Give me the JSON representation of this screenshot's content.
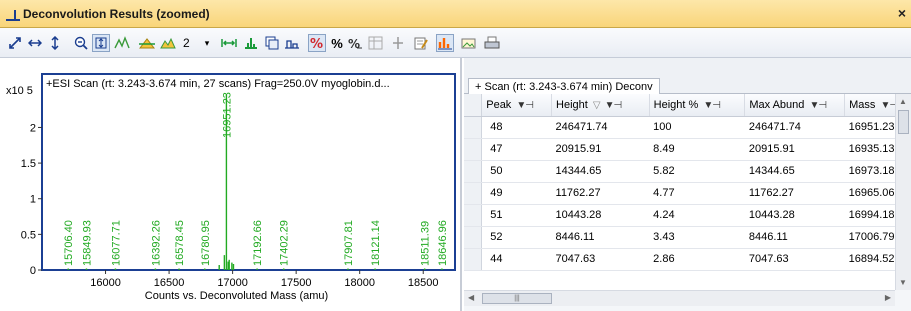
{
  "window": {
    "title": "Deconvolution Results (zoomed)",
    "close_glyph": "×",
    "title_icon": "chart-icon"
  },
  "toolbar": {
    "items": [
      "expand-arrows-icon",
      "horizontal-arrows-icon",
      "vertical-arrows-icon",
      "zoom-out-icon",
      "autoscale-y-icon",
      "peak-label-icon",
      "baseline-icon",
      "threshold-icon"
    ],
    "count_value": "2",
    "percent_label": "%",
    "accent_color": "#ff6600"
  },
  "chart_data": {
    "type": "bar",
    "title": "+ESI Scan (rt: 3.243-3.674 min, 27 scans) Frag=250.0V myoglobin.d...",
    "xlabel": "Counts vs. Deconvoluted Mass (amu)",
    "ylabel_exponent": "x10 5",
    "xlim": [
      15500,
      18750
    ],
    "ylim": [
      0,
      2.75
    ],
    "xticks": [
      16000,
      16500,
      17000,
      17500,
      18000,
      18500
    ],
    "yticks": [
      0,
      0.5,
      1,
      1.5,
      2
    ],
    "color": "#22aa22",
    "peaks": [
      {
        "x": 15706.4,
        "y": 0.0
      },
      {
        "x": 15849.93,
        "y": 0.0
      },
      {
        "x": 16077.71,
        "y": 0.0
      },
      {
        "x": 16392.26,
        "y": 0.0
      },
      {
        "x": 16578.45,
        "y": 0.0
      },
      {
        "x": 16780.95,
        "y": 0.0
      },
      {
        "x": 16894.52,
        "y": 0.07
      },
      {
        "x": 16935.13,
        "y": 0.209
      },
      {
        "x": 16951.23,
        "y": 2.465
      },
      {
        "x": 16965.06,
        "y": 0.118
      },
      {
        "x": 16973.18,
        "y": 0.143
      },
      {
        "x": 16994.18,
        "y": 0.104
      },
      {
        "x": 17006.79,
        "y": 0.084
      },
      {
        "x": 17192.66,
        "y": 0.0
      },
      {
        "x": 17402.29,
        "y": 0.0
      },
      {
        "x": 17907.81,
        "y": 0.0
      },
      {
        "x": 18121.14,
        "y": 0.0
      },
      {
        "x": 18511.39,
        "y": 0.0
      },
      {
        "x": 18646.96,
        "y": 0.0
      }
    ],
    "labels": [
      "15706.40",
      "15849.93",
      "16077.71",
      "16392.26",
      "16578.45",
      "16780.95",
      "16951.23",
      "17192.66",
      "17402.29",
      "17907.81",
      "18121.14",
      "18511.39",
      "18646.96"
    ]
  },
  "tab": {
    "label": "+ Scan (rt: 3.243-3.674 min)  Deconv"
  },
  "table": {
    "columns": [
      "Peak",
      "Height",
      "Height %",
      "Max Abund",
      "Mass"
    ],
    "sort_indicator": "▽",
    "filter_glyph": "▼⊣",
    "rows": [
      [
        "48",
        "246471.74",
        "100",
        "246471.74",
        "16951.23"
      ],
      [
        "47",
        "20915.91",
        "8.49",
        "20915.91",
        "16935.13"
      ],
      [
        "50",
        "14344.65",
        "5.82",
        "14344.65",
        "16973.18"
      ],
      [
        "49",
        "11762.27",
        "4.77",
        "11762.27",
        "16965.06"
      ],
      [
        "51",
        "10443.28",
        "4.24",
        "10443.28",
        "16994.18"
      ],
      [
        "52",
        "8446.11",
        "3.43",
        "8446.11",
        "17006.79"
      ],
      [
        "44",
        "7047.63",
        "2.86",
        "7047.63",
        "16894.52"
      ]
    ]
  }
}
